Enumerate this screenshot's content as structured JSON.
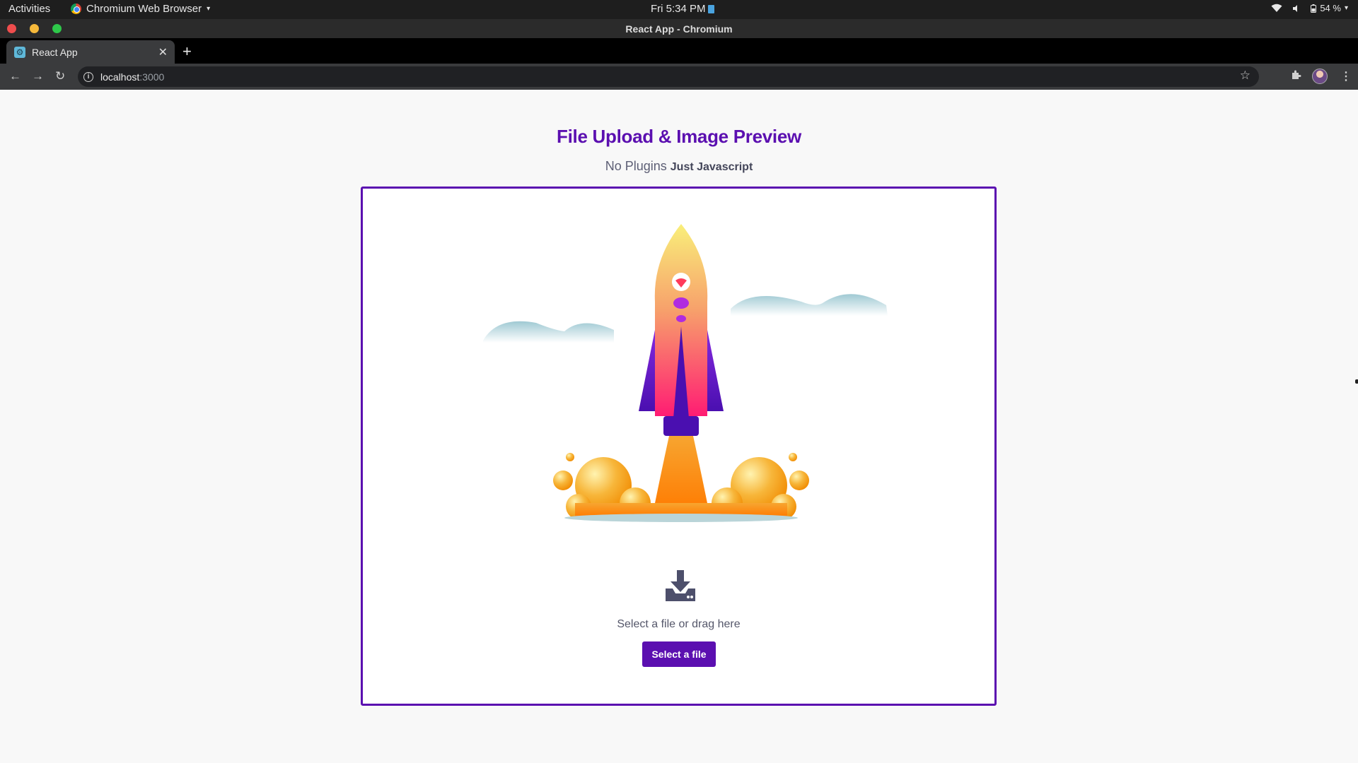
{
  "system_bar": {
    "activities": "Activities",
    "app_name": "Chromium Web Browser",
    "clock": "Fri  5:34 PM",
    "battery": "54 %"
  },
  "window": {
    "title": "React App - Chromium"
  },
  "tabs": [
    {
      "label": "React App",
      "active": true
    }
  ],
  "address_bar": {
    "host": "localhost",
    "port": ":3000"
  },
  "page": {
    "heading": "File Upload & Image Preview",
    "subheading_plain": "No Plugins",
    "subheading_strong": "Just Javascript",
    "dropzone": {
      "prompt": "Select a file or drag here",
      "button_label": "Select a file"
    }
  },
  "colors": {
    "accent": "#5b0fb0",
    "text_muted": "#55576a",
    "page_bg": "#f8f8f8"
  },
  "icons": [
    "chromium-icon",
    "wifi-icon",
    "volume-icon",
    "battery-icon",
    "back-icon",
    "forward-icon",
    "reload-icon",
    "info-icon",
    "bookmark-star-icon",
    "extensions-icon",
    "menu-icon",
    "download-icon",
    "rocket-illustration"
  ]
}
